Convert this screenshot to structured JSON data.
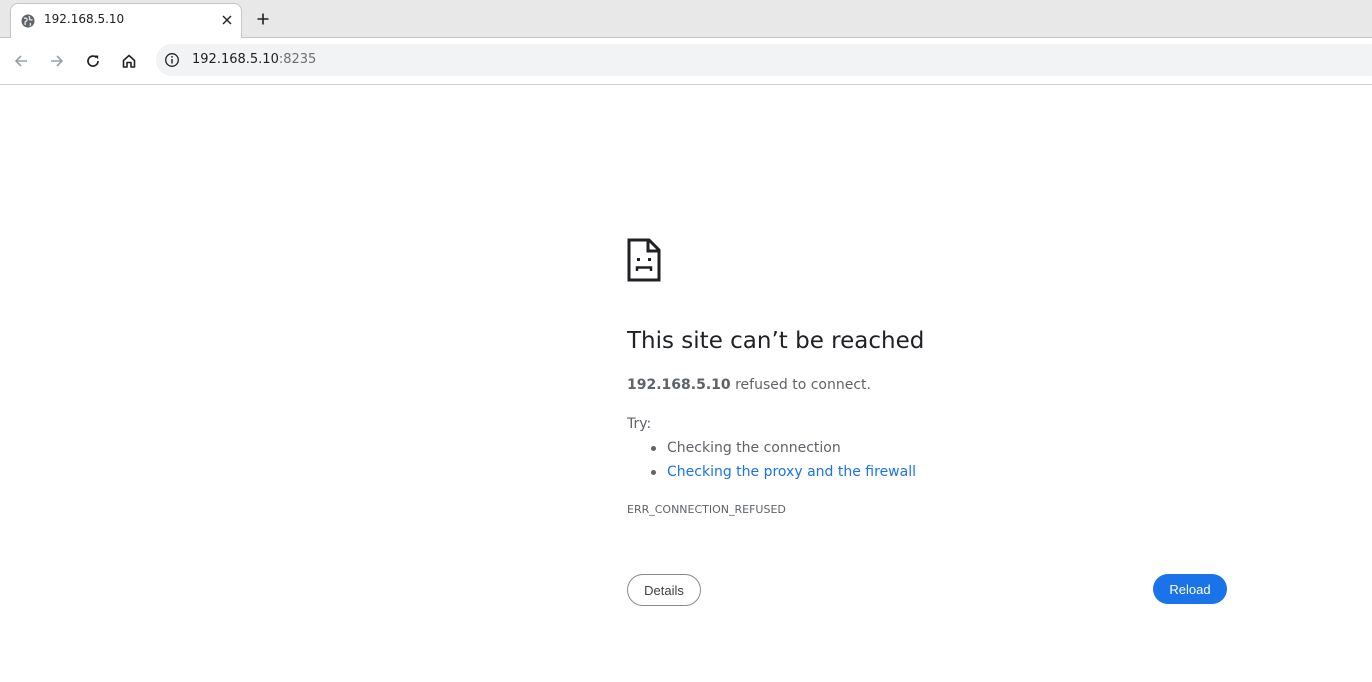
{
  "tab": {
    "title": "192.168.5.10",
    "favicon": "globe-icon"
  },
  "toolbar": {
    "url_host": "192.168.5.10",
    "url_port": ":8235"
  },
  "error": {
    "heading": "This site can’t be reached",
    "host": "192.168.5.10",
    "summary_rest": " refused to connect.",
    "try_label": "Try:",
    "suggestions": [
      "Checking the connection",
      "Checking the proxy and the firewall"
    ],
    "code": "ERR_CONNECTION_REFUSED",
    "details_label": "Details",
    "reload_label": "Reload"
  },
  "colors": {
    "accent": "#1a73e8",
    "text_primary": "#202124",
    "text_secondary": "#5f6368"
  }
}
